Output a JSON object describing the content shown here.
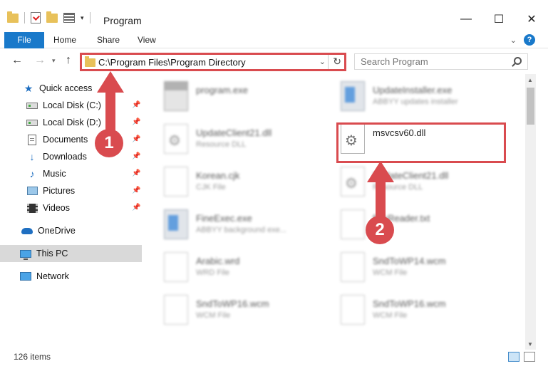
{
  "window": {
    "title": "Program",
    "controls": {
      "minimize": "—",
      "maximize": "☐",
      "close": "✕"
    }
  },
  "ribbon": {
    "tabs": [
      "File",
      "Home",
      "Share",
      "View"
    ],
    "help": "?"
  },
  "nav": {
    "address": "C:\\Program Files\\Program Directory",
    "search_placeholder": "Search Program"
  },
  "sidebar": {
    "quick_access": "Quick access",
    "items": [
      {
        "label": "Local Disk (C:)",
        "icon": "drive-icon",
        "pinned": true
      },
      {
        "label": "Local Disk (D:)",
        "icon": "drive-icon",
        "pinned": true
      },
      {
        "label": "Documents",
        "icon": "documents-icon",
        "pinned": true
      },
      {
        "label": "Downloads",
        "icon": "downloads-icon",
        "pinned": true
      },
      {
        "label": "Music",
        "icon": "music-icon",
        "pinned": true
      },
      {
        "label": "Pictures",
        "icon": "pictures-icon",
        "pinned": true
      },
      {
        "label": "Videos",
        "icon": "videos-icon",
        "pinned": true
      }
    ],
    "onedrive": "OneDrive",
    "this_pc": "This PC",
    "network": "Network"
  },
  "files": [
    {
      "name": "program.exe",
      "type": "",
      "icon": "program-icon",
      "blurred": true
    },
    {
      "name": "UpdateInstaller.exe",
      "type": "ABBYY updates installer",
      "icon": "exe-icon",
      "blurred": true
    },
    {
      "name": "UpdateClient21.dll",
      "type": "Resource DLL",
      "icon": "dll-icon",
      "blurred": true
    },
    {
      "name": "msvcsv60.dll",
      "type": "",
      "icon": "dll-icon",
      "blurred": false
    },
    {
      "name": "Korean.cjk",
      "type": "CJK File",
      "icon": "file-icon",
      "blurred": true
    },
    {
      "name": "UpdateClient21.dll",
      "type": "Resource DLL",
      "icon": "dll-icon",
      "blurred": true
    },
    {
      "name": "FineExec.exe",
      "type": "ABBYY background exe...",
      "icon": "exe-icon",
      "blurred": true
    },
    {
      "name": "fineReader.txt",
      "type": "File",
      "icon": "file-icon",
      "blurred": true
    },
    {
      "name": "Arabic.wrd",
      "type": "WRD File",
      "icon": "file-icon",
      "blurred": true
    },
    {
      "name": "SndToWP14.wcm",
      "type": "WCM File",
      "icon": "file-icon",
      "blurred": true
    },
    {
      "name": "SndToWP16.wcm",
      "type": "WCM File",
      "icon": "file-icon",
      "blurred": true
    },
    {
      "name": "SndToWP16.wcm",
      "type": "WCM File",
      "icon": "file-icon",
      "blurred": true
    }
  ],
  "status": {
    "item_count": "126 items"
  },
  "annotations": {
    "step1": "1",
    "step2": "2",
    "color": "#d94b4f"
  }
}
